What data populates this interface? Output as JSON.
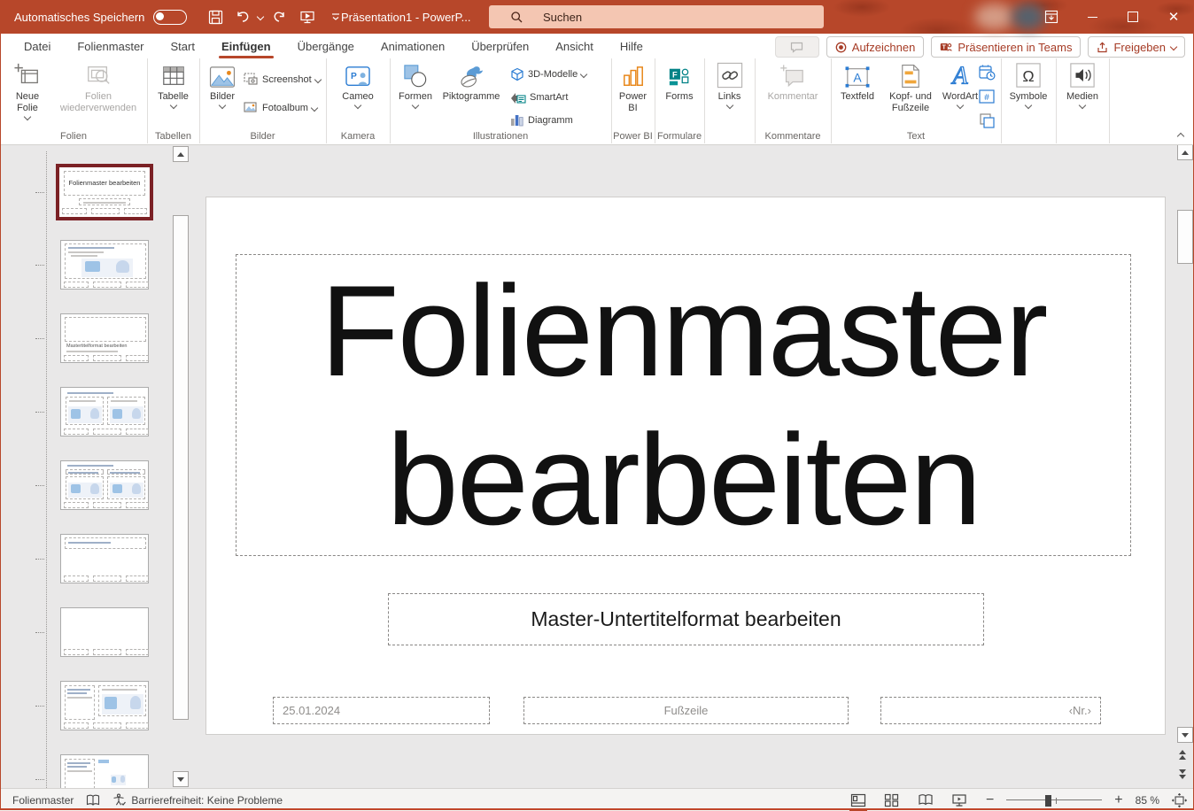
{
  "titlebar": {
    "autosave_label": "Automatisches Speichern",
    "doc_title": "Präsentation1  -  PowerP...",
    "search_label": "Suchen"
  },
  "menu": {
    "tabs": [
      {
        "label": "Datei"
      },
      {
        "label": "Folienmaster"
      },
      {
        "label": "Start"
      },
      {
        "label": "Einfügen"
      },
      {
        "label": "Übergänge"
      },
      {
        "label": "Animationen"
      },
      {
        "label": "Überprüfen"
      },
      {
        "label": "Ansicht"
      },
      {
        "label": "Hilfe"
      }
    ],
    "record_label": "Aufzeichnen",
    "teams_label": "Präsentieren in Teams",
    "share_label": "Freigeben"
  },
  "ribbon": {
    "buttons": {
      "neue_folie": "Neue Folie",
      "folien_wiederverwenden": "Folien wiederverwenden",
      "tabelle": "Tabelle",
      "bilder": "Bilder",
      "screenshot": "Screenshot",
      "fotoalbum": "Fotoalbum",
      "cameo": "Cameo",
      "formen": "Formen",
      "piktogramme": "Piktogramme",
      "modelle_3d": "3D-Modelle",
      "smartart": "SmartArt",
      "diagramm": "Diagramm",
      "power_bi": "Power BI",
      "forms": "Forms",
      "links": "Links",
      "kommentar": "Kommentar",
      "textfeld": "Textfeld",
      "kopf_fusszeile": "Kopf- und Fußzeile",
      "wordart": "WordArt",
      "symbole": "Symbole",
      "medien": "Medien"
    },
    "group_labels": {
      "folien": "Folien",
      "tabellen": "Tabellen",
      "bilder": "Bilder",
      "kamera": "Kamera",
      "illustrationen": "Illustrationen",
      "power_bi": "Power BI",
      "formulare": "Formulare",
      "kommentare": "Kommentare",
      "text": "Text"
    },
    "glyphs": {
      "omega": "Ω",
      "hash": "#",
      "wordart_a": "A",
      "textfeld_a": "A",
      "cameo_p": "P",
      "forms_f": "F"
    }
  },
  "thumbnails": {
    "slide1_title": "Folienmaster bearbeiten",
    "slide3_title": "Mastertitelformat bearbeiten"
  },
  "slide": {
    "title": "Folienmaster bearbeiten",
    "subtitle": "Master-Untertitelformat bearbeiten",
    "date": "25.01.2024",
    "footer": "Fußzeile",
    "number": "‹Nr.›"
  },
  "statusbar": {
    "view_name": "Folienmaster",
    "accessibility": "Barrierefreiheit: Keine Probleme",
    "zoom_level": "85 %"
  },
  "icons": [
    "save-icon",
    "undo-icon",
    "redo-icon",
    "start-slideshow-icon",
    "customize-qat-icon",
    "search-icon",
    "ribbon-display-options-icon",
    "minimize-icon",
    "maximize-icon",
    "close-icon",
    "comment-icon",
    "record-icon",
    "teams-icon",
    "share-icon",
    "new-slide-icon",
    "reuse-slides-icon",
    "table-icon",
    "pictures-icon",
    "screenshot-icon",
    "photo-album-icon",
    "cameo-icon",
    "shapes-icon",
    "icons-duck-icon",
    "3d-models-icon",
    "smartart-icon",
    "chart-icon",
    "power-bi-icon",
    "forms-icon",
    "link-icon",
    "new-comment-icon",
    "text-box-icon",
    "header-footer-icon",
    "wordart-icon",
    "date-time-icon",
    "slide-number-icon",
    "object-icon",
    "symbol-omega-icon",
    "media-speaker-icon",
    "spellcheck-book-icon",
    "accessibility-icon",
    "normal-view-icon",
    "slide-sorter-icon",
    "reading-view-icon",
    "slideshow-view-icon",
    "zoom-out-icon",
    "zoom-in-icon",
    "fit-to-window-icon"
  ],
  "colors": {
    "titlebar_bg": "#b7472a",
    "accent": "#b7472a",
    "search_bg": "#f4c6b2",
    "thumb_selection_border": "#7b2125",
    "icon_blue": "#2b7cd3",
    "icon_orange": "#e8871a",
    "icon_teal": "#038387",
    "disabled_text": "#a8a6a4"
  }
}
